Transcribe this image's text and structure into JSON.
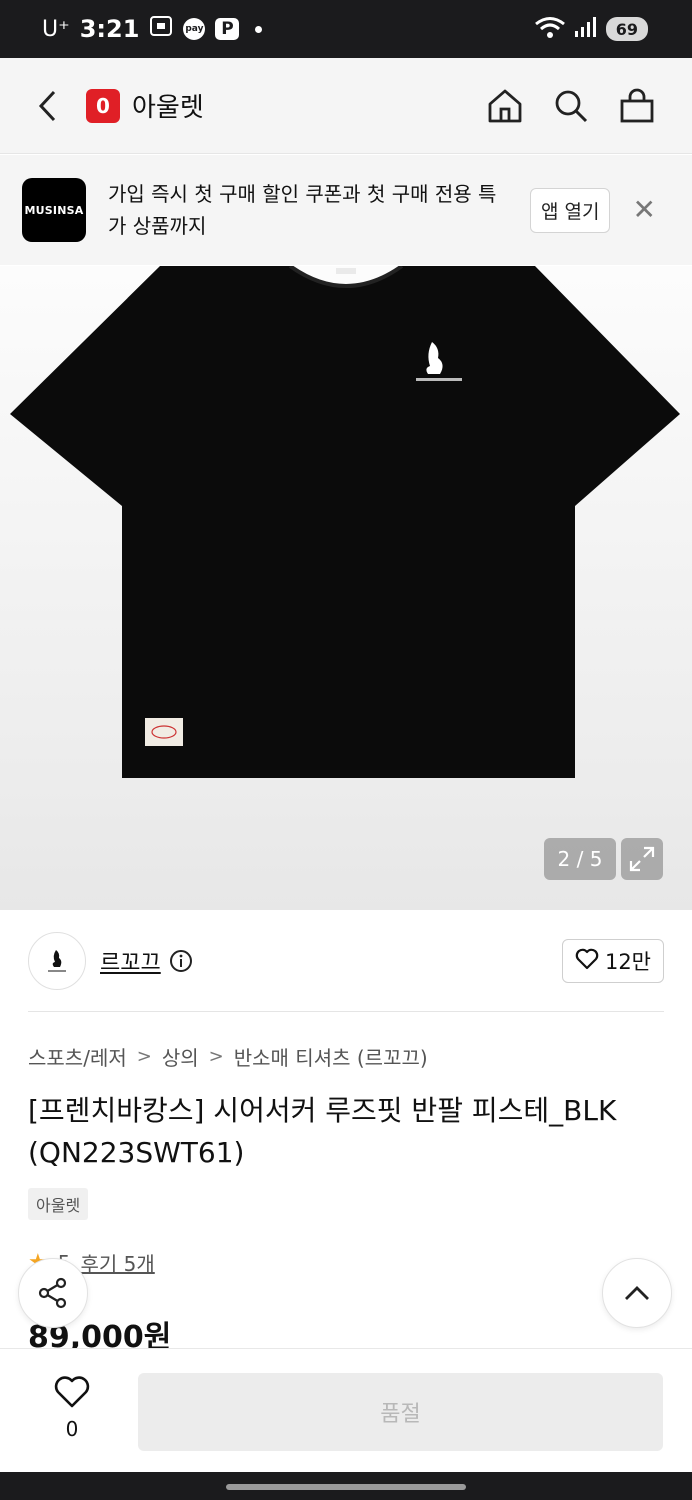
{
  "status_bar": {
    "carrier": "U⁺",
    "time": "3:21",
    "battery": "69",
    "icons": [
      "screenshot-icon",
      "pay-icon",
      "parking-icon",
      "notification-dot-icon",
      "wifi-icon",
      "signal-icon",
      "battery-icon"
    ]
  },
  "header": {
    "logo_letter": "0",
    "title": "아울렛",
    "icons": [
      "back-icon",
      "home-icon",
      "search-icon",
      "cart-icon"
    ]
  },
  "app_banner": {
    "logo_text": "MUSINSA",
    "message": "가입 즉시 첫 구매 할인 쿠폰과 첫 구매 전용 특가 상품까지",
    "open_button": "앱 열기"
  },
  "gallery": {
    "counter": "2 / 5"
  },
  "brand": {
    "name": "르꼬끄",
    "likes": "12만"
  },
  "breadcrumb": [
    "스포츠/레저",
    "상의",
    "반소매 티셔츠 (르꼬끄)"
  ],
  "product": {
    "title": "[프렌치바캉스] 시어서커 루즈핏 반팔 피스테_BLK (QN223SWT61)",
    "tag": "아울렛",
    "rating": "5",
    "reviews": "후기 5개",
    "price": "89,000원"
  },
  "bottom_bar": {
    "wish_count": "0",
    "action_label": "품절"
  },
  "colors": {
    "brand_red": "#e01f26",
    "star": "#f5a623",
    "disabled_bg": "#ececec"
  }
}
